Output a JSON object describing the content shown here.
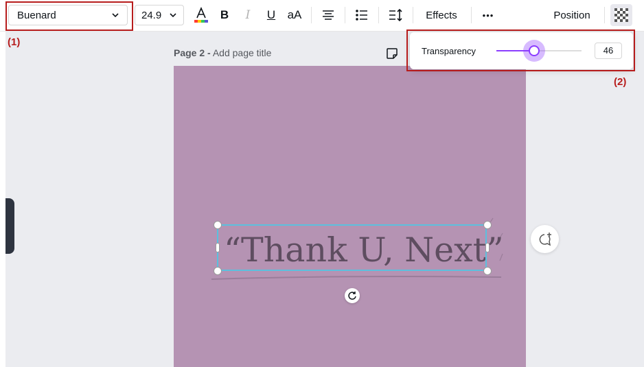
{
  "toolbar": {
    "font_name": "Buenard",
    "font_size": "24.9",
    "bold_label": "B",
    "italic_label": "I",
    "underline_label": "U",
    "case_label": "aA",
    "effects_label": "Effects",
    "more_label": "•••",
    "position_label": "Position"
  },
  "annotations": {
    "label_1": "(1)",
    "label_2": "(2)"
  },
  "page": {
    "number_label": "Page 2 -",
    "title_placeholder": "Add page title",
    "background_color": "#b593b3"
  },
  "canvas_text": {
    "content": "“Thank U, Next”",
    "color": "#5e4d60"
  },
  "transparency": {
    "label": "Transparency",
    "value": "46",
    "slider_fraction": 0.46,
    "accent_color": "#8b3dff"
  },
  "icons": {
    "text_color": "text-color-icon",
    "align": "align-center-icon",
    "list": "bullet-list-icon",
    "spacing": "line-spacing-icon",
    "transparency": "checkerboard-transparency-icon",
    "note": "page-note-icon",
    "comment": "add-comment-icon",
    "rotate": "rotate-icon"
  }
}
